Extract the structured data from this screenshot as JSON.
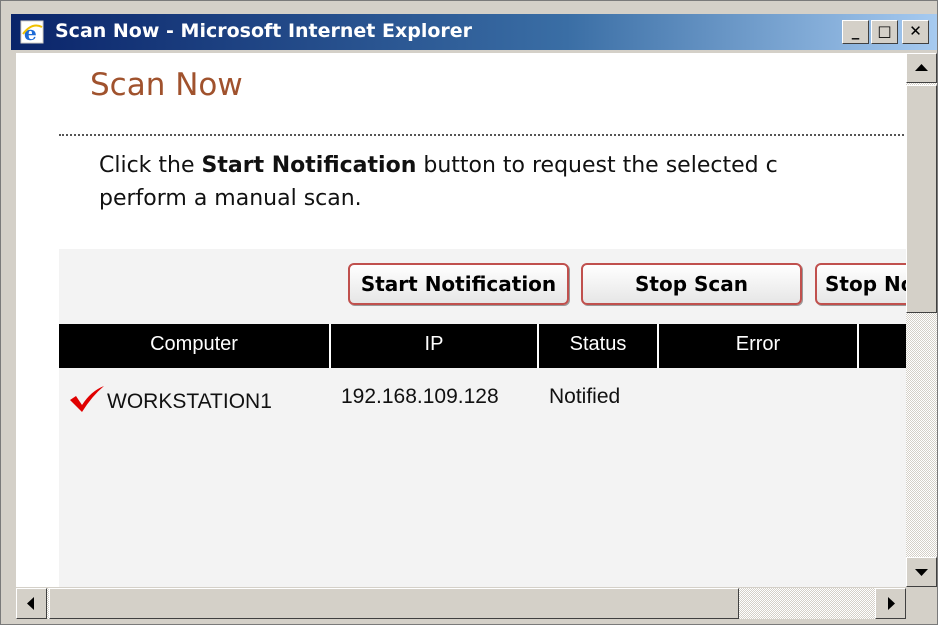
{
  "window": {
    "title": "Scan Now - Microsoft Internet Explorer",
    "buttons": {
      "minimize": "_",
      "maximize": "□",
      "close": "✕"
    }
  },
  "page": {
    "heading": "Scan Now",
    "instruction": {
      "line1_pre": "Click the ",
      "line1_bold": "Start Notification",
      "line1_post": " button to request the selected c",
      "line2": "perform a manual scan."
    }
  },
  "actions": {
    "start_notification": "Start Notification",
    "stop_scan": "Stop Scan",
    "stop_notification": "Stop Notification"
  },
  "table": {
    "columns": [
      "Computer",
      "IP",
      "Status",
      "Error"
    ],
    "rows": [
      {
        "computer": "WORKSTATION1",
        "ip": "192.168.109.128",
        "status": "Notified",
        "error": "",
        "checked": true
      }
    ]
  },
  "colors": {
    "heading": "#a0522d",
    "button_border": "#c0504d",
    "checkmark": "#e00000",
    "table_header_bg": "#000000"
  },
  "icons": [
    "ie-icon",
    "checkmark-icon",
    "scroll-up-icon",
    "scroll-down-icon",
    "scroll-left-icon",
    "scroll-right-icon"
  ]
}
